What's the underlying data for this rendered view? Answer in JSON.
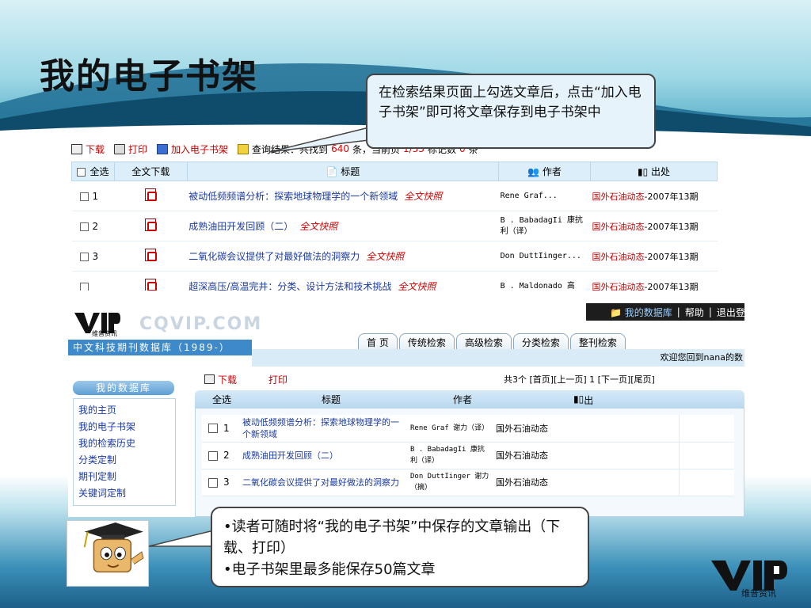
{
  "slide": {
    "title": "我的电子书架"
  },
  "callouts": {
    "top": "在检索结果页面上勾选文章后，点击“加入电子书架”即可将文章保存到电子书架中",
    "bottom_line1": "•读者可随时将“我的电子书架”中保存的文章输出（下载、打印）",
    "bottom_line2": "•电子书架里最多能保存50篇文章"
  },
  "screenshot1": {
    "toolbar": {
      "download": "下载",
      "print": "打印",
      "add_shelf": "加入电子书架",
      "result_prefix": "查询结果：共找到",
      "result_count": "640",
      "result_mid": "条，当前页",
      "page": "1/33",
      "marked_label": "标记数",
      "marked": "0",
      "result_suffix": "条"
    },
    "headers": {
      "select_all": "全选",
      "fulltext": "全文下载",
      "title": "标题",
      "author": "作者",
      "source": "出处"
    },
    "fulltext_link": "全文快照",
    "rows": [
      {
        "num": "1",
        "title": "被动低频频谱分析：探索地球物理学的一个新领域",
        "author": "Rene Graf...",
        "source": "国外石油动态",
        "issue": "-2007年13期"
      },
      {
        "num": "2",
        "title": "成熟油田开发回顾（二）",
        "author": "B . BabadagIi 康抗利（译）",
        "source": "国外石油动态",
        "issue": "-2007年13期"
      },
      {
        "num": "3",
        "title": "二氧化碳会议提供了对最好做法的洞察力",
        "author": "Don DuttIinger...",
        "source": "国外石油动态",
        "issue": "-2007年13期"
      },
      {
        "num": "",
        "title": "超深高压/高温完井：分类、设计方法和技术挑战",
        "author": "B . Maldonado 高",
        "source": "国外石油动态",
        "issue": "-2007年13期"
      }
    ]
  },
  "screenshot2": {
    "topbar": {
      "mydb": "我的数据库",
      "help": "帮助",
      "logout": "退出登录"
    },
    "brand": {
      "logo_sub": "维普资讯",
      "cqvip": "CQVIP.COM",
      "db_name": "中文科技期刊数据库（1989-）"
    },
    "nav": [
      "首  页",
      "传统检索",
      "高级检索",
      "分类检索",
      "整刊检索"
    ],
    "welcome": "欢迎您回到nana的数",
    "sidebar": {
      "heading": "我的数据库",
      "items": [
        "我的主页",
        "我的电子书架",
        "我的检索历史",
        "分类定制",
        "期刊定制",
        "关键词定制"
      ]
    },
    "toolbar": {
      "download": "下载",
      "print": "打印",
      "pager": "共3个 [首页][上一页] 1 [下一页][尾页]"
    },
    "headers": {
      "select_all": "全选",
      "title": "标题",
      "author": "作者",
      "source": "出处"
    },
    "rows": [
      {
        "num": "1",
        "title": "被动低频频谱分析：探索地球物理学的一个新领域",
        "author": "Rene Graf 谢力（译）",
        "source": "国外石油动态"
      },
      {
        "num": "2",
        "title": "成熟油田开发回顾（二）",
        "author": "B . BabadagIi 康抗利（译）",
        "source": "国外石油动态"
      },
      {
        "num": "3",
        "title": "二氧化碳会议提供了对最好做法的洞察力",
        "author": "Don DuttIinger 谢力（摘）",
        "source": "国外石油动态"
      }
    ]
  },
  "footer_logo": {
    "caption": "维普资讯"
  }
}
